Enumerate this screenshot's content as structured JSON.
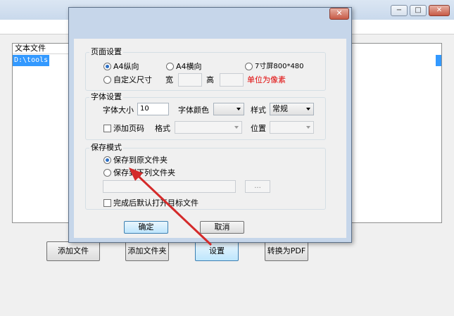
{
  "main": {
    "list_header": "文本文件",
    "list_item": "D:\\tools",
    "buttons": {
      "add_file": "添加文件",
      "add_folder": "添加文件夹",
      "settings": "设置",
      "convert": "转换为PDF"
    }
  },
  "window_controls": {
    "minimize": "−",
    "maximize": "□",
    "close": "✕"
  },
  "dialog": {
    "close": "✕",
    "page": {
      "title": "页面设置",
      "a4_portrait": "A4纵向",
      "a4_landscape": "A4横向",
      "screen7": "7寸屏800*480",
      "custom": "自定义尺寸",
      "width_label": "宽",
      "height_label": "高",
      "unit_note": "单位为像素",
      "selected": "A4纵向"
    },
    "font": {
      "title": "字体设置",
      "size_label": "字体大小",
      "size_value": "10",
      "color_label": "字体颜色",
      "style_label": "样式",
      "style_value": "常规",
      "page_number_label": "添加页码",
      "format_label": "格式",
      "position_label": "位置"
    },
    "save": {
      "title": "保存模式",
      "original": "保存到原文件夹",
      "folder": "保存到下列文件夹",
      "browse": "...",
      "open_after": "完成后默认打开目标文件",
      "selected": "保存到原文件夹"
    },
    "ok": "确定",
    "cancel": "取消"
  },
  "colors": {
    "arrow": "#d42a2a",
    "selection": "#3399ff",
    "unit_note": "#e00000"
  }
}
